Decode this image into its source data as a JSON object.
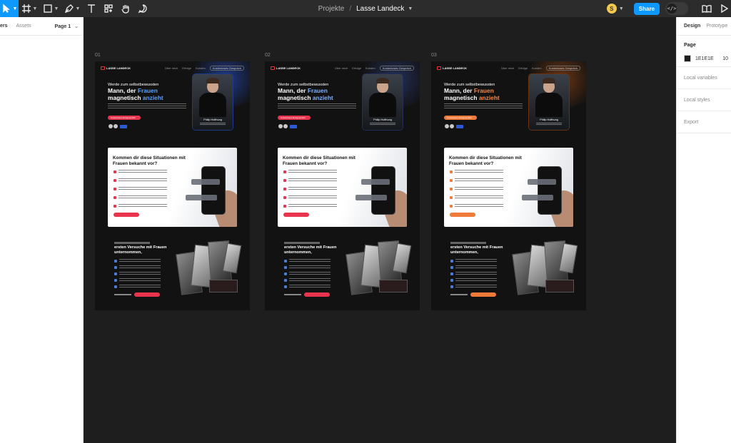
{
  "toolbar": {
    "tools": [
      "move-tool",
      "frame-tool",
      "shape-tool",
      "pen-tool",
      "text-tool",
      "resources-tool",
      "hand-tool",
      "comment-tool"
    ],
    "breadcrumb_project": "Projekte",
    "breadcrumb_separator": "/",
    "file_name": "Lasse Landeck",
    "user_initial": "S",
    "share_label": "Share",
    "dev_mode_icon": "</>",
    "accent": "#0d99ff"
  },
  "left_panel": {
    "tab_layers": "ers",
    "tab_assets": "Assets",
    "page_selector": "Page 1"
  },
  "right_panel": {
    "tab_design": "Design",
    "tab_prototype": "Prototype",
    "page_heading": "Page",
    "page_color": "1E1E1E",
    "page_opacity": "10",
    "local_variables": "Local variables",
    "local_styles": "Local styles",
    "export": "Export"
  },
  "canvas": {
    "background": "#1e1e1e",
    "frames": [
      {
        "label": "01",
        "accent": "#e8344e",
        "glow": "#1f3a8a",
        "highlight_color": "#5aa0ff",
        "logo_text": "LASSE LANDECK",
        "nav_links": [
          "Über mich",
          "Erfolge",
          "Kunden"
        ],
        "nav_cta": "Kostenloses Gespräch",
        "hero_kicker": "Werde zum selbstbewussten",
        "hero_title_1": "Mann, der ",
        "hero_title_hl1": "Frauen",
        "hero_title_2": "magnetisch ",
        "hero_title_hl2": "anzieht",
        "hero_button": "Kostenloses Erstgespräch",
        "portrait_name": "Philip Hoffnung",
        "section2_title": "Kommen dir diese Situationen mit Frauen bekannt vor?",
        "section3_title": "ersten Versuche mit Frauen unternommen,"
      },
      {
        "label": "02",
        "accent": "#e8344e",
        "glow": "#24305a",
        "highlight_color": "#7fb0ff",
        "logo_text": "LASSE LANDECK",
        "nav_links": [
          "Über mich",
          "Erfolge",
          "Kunden"
        ],
        "nav_cta": "Kostenloses Gespräch",
        "hero_kicker": "Werde zum selbstbewussten",
        "hero_title_1": "Mann, der ",
        "hero_title_hl1": "Frauen",
        "hero_title_2": "magnetisch ",
        "hero_title_hl2": "anzieht",
        "hero_button": "Kostenloses Erstgespräch",
        "portrait_name": "Philip Hoffnung",
        "section2_title": "Kommen dir diese Situationen mit Frauen bekannt vor?",
        "section3_title": "ersten Versuche mit Frauen unternommen,"
      },
      {
        "label": "03",
        "accent": "#f07a3a",
        "glow": "#6a3412",
        "highlight_color": "#f08a4a",
        "logo_text": "LASSE LANDECK",
        "nav_links": [
          "Über mich",
          "Erfolge",
          "Kunden"
        ],
        "nav_cta": "Kostenloses Gespräch",
        "hero_kicker": "Werde zum selbstbewussten",
        "hero_title_1": "Mann, der ",
        "hero_title_hl1": "Frauen",
        "hero_title_2": "magnetisch ",
        "hero_title_hl2": "anzieht",
        "hero_button": "Kostenloses Erstgespräch",
        "portrait_name": "Philip Hoffnung",
        "section2_title": "Kommen dir diese Situationen mit Frauen bekannt vor?",
        "section3_title": "ersten Versuche mit Frauen unternommen,"
      }
    ]
  }
}
